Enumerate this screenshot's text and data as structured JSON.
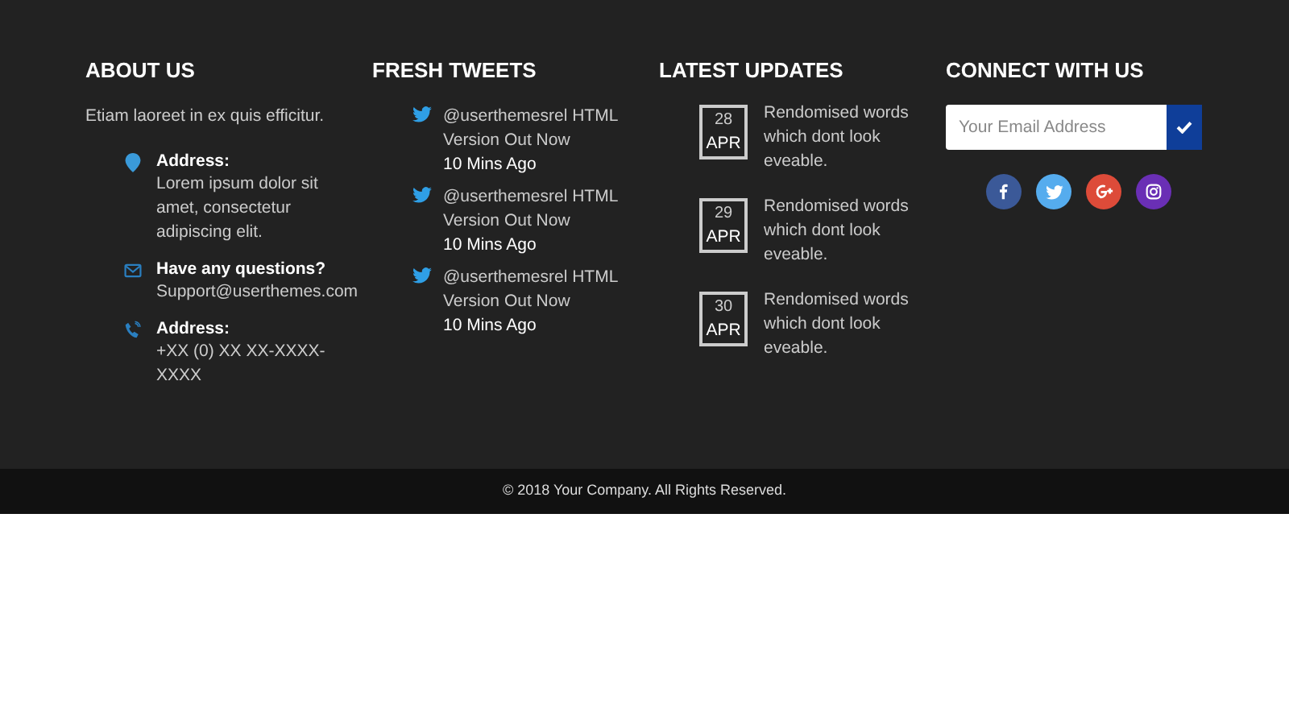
{
  "about": {
    "heading": "ABOUT US",
    "intro": "Etiam laoreet in ex quis efficitur.",
    "contacts": [
      {
        "kind": "address",
        "label": "Address:",
        "lines": [
          "Lorem ipsum dolor sit",
          "amet, consectetur",
          "adipiscing elit."
        ]
      },
      {
        "kind": "email",
        "label": "Have any questions?",
        "lines": [
          "Support@userthemes.com"
        ]
      },
      {
        "kind": "phone",
        "label": "Address:",
        "lines": [
          "+XX (0) XX XX-XXXX-",
          "XXXX"
        ]
      }
    ]
  },
  "tweets": {
    "heading": "FRESH TWEETS",
    "items": [
      {
        "text": [
          "@userthemesrel HTML",
          "Version Out Now"
        ],
        "time": "10 Mins Ago"
      },
      {
        "text": [
          "@userthemesrel HTML",
          "Version Out Now"
        ],
        "time": "10 Mins Ago"
      },
      {
        "text": [
          "@userthemesrel HTML",
          "Version Out Now"
        ],
        "time": "10 Mins Ago"
      }
    ]
  },
  "updates": {
    "heading": "LATEST UPDATES",
    "items": [
      {
        "day": "28",
        "month": "APR",
        "text": [
          "Rendomised words",
          "which dont look",
          "eveable."
        ]
      },
      {
        "day": "29",
        "month": "APR",
        "text": [
          "Rendomised words",
          "which dont look",
          "eveable."
        ]
      },
      {
        "day": "30",
        "month": "APR",
        "text": [
          "Rendomised words",
          "which dont look",
          "eveable."
        ]
      }
    ]
  },
  "connect": {
    "heading": "CONNECT WITH US",
    "email": {
      "placeholder": "Your Email Address"
    },
    "social": [
      {
        "kind": "facebook",
        "color": "#3b5998"
      },
      {
        "kind": "twitter",
        "color": "#55acee"
      },
      {
        "kind": "google_plus",
        "color": "#dd4b39"
      },
      {
        "kind": "instagram",
        "color": "#6a2fb5"
      }
    ]
  },
  "copyright": "© 2018 Your Company. All Rights Reserved."
}
